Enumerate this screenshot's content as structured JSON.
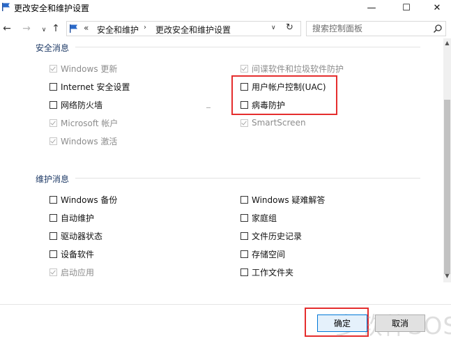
{
  "window": {
    "title": "更改安全和维护设置",
    "minimize": "—",
    "maximize": "☐",
    "close": "✕"
  },
  "nav": {
    "back": "←",
    "forward": "→",
    "recent": "∨",
    "up": "↑",
    "chevron": "«",
    "breadcrumbs": [
      "安全和维护",
      "更改安全和维护设置"
    ],
    "separator": "›",
    "dropdown": "∨",
    "refresh": "↻"
  },
  "search": {
    "placeholder": "搜索控制面板"
  },
  "security": {
    "title": "安全消息",
    "items": [
      {
        "label": "Windows 更新",
        "checked": true,
        "disabled": true
      },
      {
        "label": "间谍软件和垃圾软件防护",
        "checked": true,
        "disabled": true
      },
      {
        "label": "Internet 安全设置",
        "checked": false,
        "disabled": false
      },
      {
        "label": "用户帐户控制(UAC)",
        "checked": false,
        "disabled": false
      },
      {
        "label": "网络防火墙",
        "checked": false,
        "disabled": false
      },
      {
        "label": "病毒防护",
        "checked": false,
        "disabled": false
      },
      {
        "label": "Microsoft 帐户",
        "checked": true,
        "disabled": true
      },
      {
        "label": "SmartScreen",
        "checked": true,
        "disabled": true
      },
      {
        "label": "Windows 激活",
        "checked": true,
        "disabled": true
      }
    ]
  },
  "maintenance": {
    "title": "维护消息",
    "items": [
      {
        "label": "Windows 备份",
        "checked": false,
        "disabled": false
      },
      {
        "label": "Windows 疑难解答",
        "checked": false,
        "disabled": false
      },
      {
        "label": "自动维护",
        "checked": false,
        "disabled": false
      },
      {
        "label": "家庭组",
        "checked": false,
        "disabled": false
      },
      {
        "label": "驱动器状态",
        "checked": false,
        "disabled": false
      },
      {
        "label": "文件历史记录",
        "checked": false,
        "disabled": false
      },
      {
        "label": "设备软件",
        "checked": false,
        "disabled": false
      },
      {
        "label": "存储空间",
        "checked": false,
        "disabled": false
      },
      {
        "label": "启动应用",
        "checked": true,
        "disabled": true
      },
      {
        "label": "工作文件夹",
        "checked": false,
        "disabled": false
      }
    ]
  },
  "buttons": {
    "ok": "确定",
    "cancel": "取消"
  },
  "watermark": "多软件SOS",
  "colors": {
    "highlight": "#e52d2d",
    "accent": "#0078d7",
    "group_title": "#1e3a66"
  }
}
